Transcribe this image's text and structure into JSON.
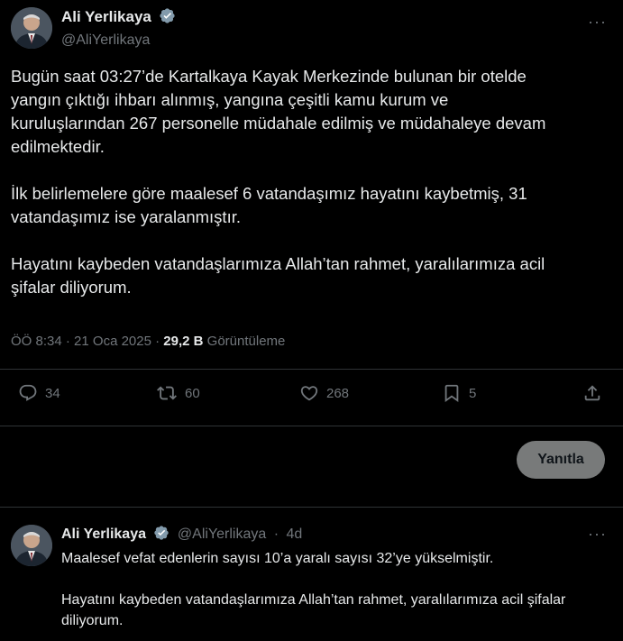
{
  "post": {
    "author_name": "Ali Yerlikaya",
    "handle": "@AliYerlikaya",
    "more_icon": "···",
    "paragraphs": [
      "Bugün saat 03:27’de Kartalkaya Kayak Merkezinde bulunan bir otelde\nyangın çıktığı ihbarı alınmış, yangına çeşitli kamu kurum ve\nkuruluşlarından 267 personelle müdahale edilmiş ve müdahaleye devam\nedilmektedir.",
      "İlk belirlemelere göre maalesef 6 vatandaşımız hayatını kaybetmiş, 31\nvatandaşımız ise yaralanmıştır.",
      "Hayatını kaybeden vatandaşlarımıza Allah’tan rahmet, yaralılarımıza acil\nşifalar diliyorum."
    ],
    "time": "ÖÖ 8:34",
    "date": "21 Oca 2025",
    "views_count": "29,2 B",
    "views_label": "Görüntüleme",
    "separator": "·"
  },
  "actions": {
    "replies": "34",
    "reposts": "60",
    "likes": "268",
    "bookmarks": "5"
  },
  "reply_button_label": "Yanıtla",
  "reply": {
    "author_name": "Ali Yerlikaya",
    "handle": "@AliYerlikaya",
    "separator": "·",
    "age": "4d",
    "more_icon": "···",
    "paragraphs": [
      "Maalesef vefat edenlerin sayısı 10’a yaralı sayısı 32’ye yükselmiştir.",
      "Hayatını kaybeden vatandaşlarımıza Allah’tan rahmet, yaralılarımıza acil şifalar diliyorum."
    ]
  },
  "colors": {
    "background": "#000000",
    "text": "#e7e9ea",
    "muted": "#71767b",
    "verified_badge": "#829aab",
    "reply_button": "#787a7a"
  },
  "icons": {
    "verified": "verified-badge-icon",
    "reply": "comment-icon",
    "repost": "repost-icon",
    "like": "heart-icon",
    "bookmark": "bookmark-icon",
    "share": "share-icon",
    "more": "more-icon"
  }
}
